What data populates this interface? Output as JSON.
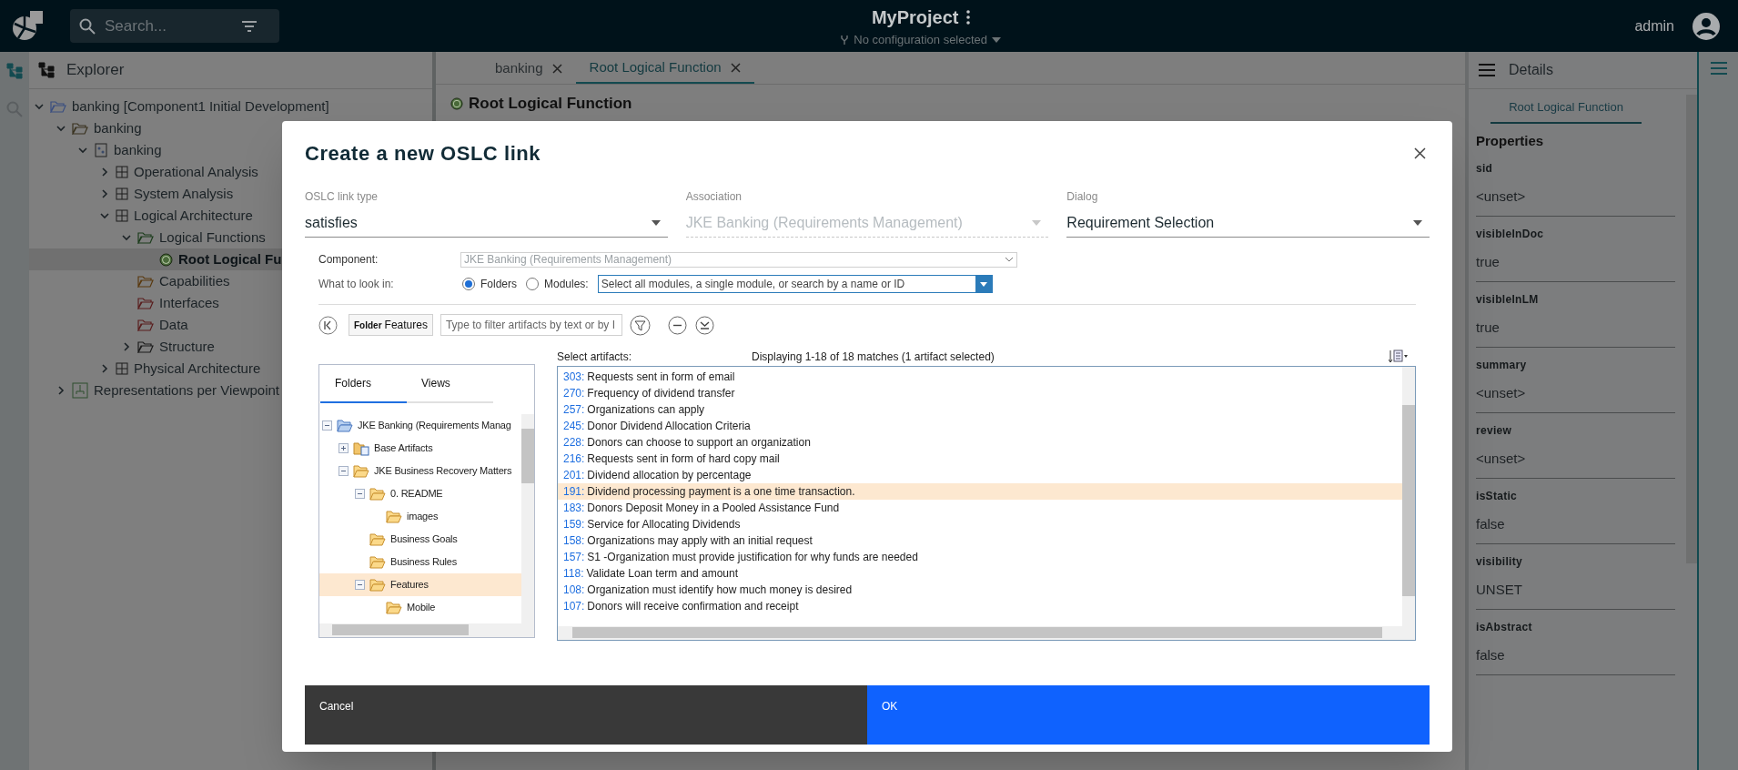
{
  "topbar": {
    "search_placeholder": "Search...",
    "project": "MyProject",
    "configuration": "No configuration selected",
    "user": "admin"
  },
  "explorer": {
    "title": "Explorer",
    "tree": [
      {
        "label": "banking [Component1 Initial Development]",
        "kind": "project",
        "expanded": true,
        "selected": false,
        "children": [
          {
            "label": "banking",
            "kind": "model-folder",
            "expanded": true,
            "selected": false,
            "children": [
              {
                "label": "banking",
                "kind": "model",
                "expanded": true,
                "selected": false,
                "children": [
                  {
                    "label": "Operational Analysis",
                    "kind": "package",
                    "expanded": false,
                    "selected": false
                  },
                  {
                    "label": "System Analysis",
                    "kind": "package",
                    "expanded": false,
                    "selected": false
                  },
                  {
                    "label": "Logical Architecture",
                    "kind": "package",
                    "expanded": true,
                    "selected": false,
                    "children": [
                      {
                        "label": "Logical Functions",
                        "kind": "green-folder",
                        "expanded": true,
                        "selected": false,
                        "children": [
                          {
                            "label": "Root Logical Fu",
                            "kind": "function",
                            "selected": true
                          }
                        ]
                      },
                      {
                        "label": "Capabilities",
                        "kind": "orange-folder",
                        "selected": false
                      },
                      {
                        "label": "Interfaces",
                        "kind": "red-folder",
                        "selected": false
                      },
                      {
                        "label": "Data",
                        "kind": "red-folder",
                        "selected": false
                      },
                      {
                        "label": "Structure",
                        "kind": "plain-folder",
                        "expanded": false,
                        "selected": false
                      }
                    ]
                  },
                  {
                    "label": "Physical Architecture",
                    "kind": "package",
                    "expanded": false,
                    "selected": false
                  }
                ]
              }
            ]
          },
          {
            "label": "Representations per Viewpoint",
            "kind": "viewpoint",
            "expanded": false,
            "selected": false
          }
        ]
      }
    ]
  },
  "editor": {
    "tabs": [
      {
        "label": "banking",
        "selected": false
      },
      {
        "label": "Root Logical Function",
        "selected": true
      }
    ],
    "heading": "Root Logical Function"
  },
  "details": {
    "title": "Details",
    "tab": "Root Logical Function",
    "section": "Properties",
    "properties": [
      {
        "name": "sid",
        "value": "<unset>"
      },
      {
        "name": "visibleInDoc",
        "value": "true"
      },
      {
        "name": "visibleInLM",
        "value": "true"
      },
      {
        "name": "summary",
        "value": "<unset>"
      },
      {
        "name": "review",
        "value": "<unset>"
      },
      {
        "name": "isStatic",
        "value": "false"
      },
      {
        "name": "visibility",
        "value": "UNSET"
      },
      {
        "name": "isAbstract",
        "value": "false"
      }
    ]
  },
  "dialog": {
    "title": "Create a new OSLC link",
    "fields": [
      {
        "label": "OSLC link type",
        "value": "satisfies",
        "disabled": false
      },
      {
        "label": "Association",
        "value": "JKE Banking (Requirements Management)",
        "disabled": true
      },
      {
        "label": "Dialog",
        "value": "Requirement Selection",
        "disabled": false
      }
    ],
    "component": {
      "label": "Component:",
      "value": "JKE Banking (Requirements Management)"
    },
    "look_in": {
      "label": "What to look in:",
      "options": [
        {
          "label": "Folders",
          "selected": true
        },
        {
          "label": "Modules:",
          "selected": false
        }
      ],
      "modules_placeholder": "Select all modules, a single module, or search by a name or ID"
    },
    "scope": {
      "kind_label": "Folder",
      "name": "Features"
    },
    "filter_placeholder": "Type to filter artifacts by text or by I",
    "folder_tabs": [
      {
        "label": "Folders",
        "selected": true
      },
      {
        "label": "Views",
        "selected": false
      }
    ],
    "folders": [
      {
        "label": "JKE Banking (Requirements Manag",
        "kind": "project",
        "expanded": true,
        "selected": false,
        "children": [
          {
            "label": "Base Artifacts",
            "kind": "artifacts",
            "expanded": false,
            "selected": false
          },
          {
            "label": "JKE Business Recovery Matters",
            "kind": "folder",
            "expanded": true,
            "selected": false,
            "children": [
              {
                "label": "0. README",
                "kind": "folder",
                "expanded": true,
                "selected": false,
                "children": [
                  {
                    "label": "images",
                    "kind": "folder",
                    "selected": false
                  }
                ]
              },
              {
                "label": "Business Goals",
                "kind": "folder",
                "selected": false
              },
              {
                "label": "Business Rules",
                "kind": "folder",
                "selected": false
              },
              {
                "label": "Features",
                "kind": "folder",
                "expanded": true,
                "selected": true,
                "children": [
                  {
                    "label": "Mobile",
                    "kind": "folder",
                    "selected": false
                  }
                ]
              }
            ]
          }
        ]
      }
    ],
    "artifacts_label": "Select artifacts:",
    "match_count": "Displaying 1-18 of 18 matches (1 artifact selected)",
    "artifacts": [
      {
        "id": "303:",
        "text": "Requests sent in form of email",
        "selected": false
      },
      {
        "id": "270:",
        "text": "Frequency of dividend transfer",
        "selected": false
      },
      {
        "id": "257:",
        "text": "Organizations can apply",
        "selected": false
      },
      {
        "id": "245:",
        "text": "Donor Dividend Allocation Criteria",
        "selected": false
      },
      {
        "id": "228:",
        "text": "Donors can choose to support an organization",
        "selected": false
      },
      {
        "id": "216:",
        "text": "Requests sent in form of hard copy mail",
        "selected": false
      },
      {
        "id": "201:",
        "text": "Dividend allocation by percentage",
        "selected": false
      },
      {
        "id": "191:",
        "text": "Dividend processing payment is a one time transaction.",
        "selected": true
      },
      {
        "id": "183:",
        "text": "Donors Deposit Money in a Pooled Assistance Fund",
        "selected": false
      },
      {
        "id": "159:",
        "text": "Service for Allocating Dividends",
        "selected": false
      },
      {
        "id": "158:",
        "text": "Organizations may apply with an initial request",
        "selected": false
      },
      {
        "id": "157:",
        "text": "S1 -Organization must provide justification for why funds are needed",
        "selected": false
      },
      {
        "id": "118:",
        "text": "Validate Loan term and amount",
        "selected": false
      },
      {
        "id": "108:",
        "text": "Organization must identify how much money is desired",
        "selected": false
      },
      {
        "id": "107:",
        "text": "Donors will receive confirmation and receipt",
        "selected": false
      }
    ],
    "buttons": [
      {
        "label": "Cancel",
        "kind": "secondary"
      },
      {
        "label": "OK",
        "kind": "primary"
      }
    ]
  }
}
